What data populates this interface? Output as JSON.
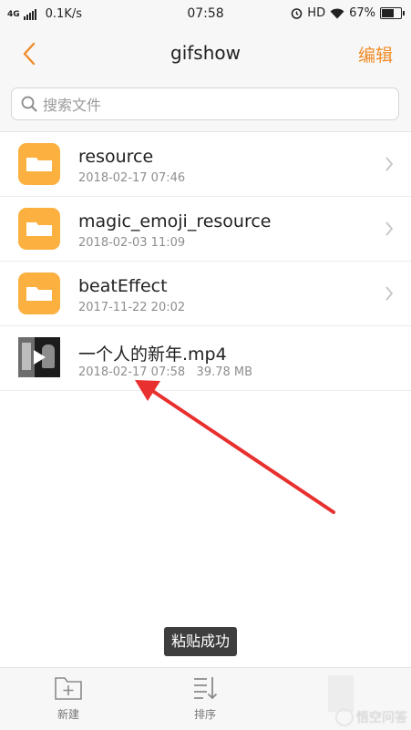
{
  "status_bar": {
    "network": "4G",
    "speed": "0.1K/s",
    "time": "07:58",
    "hd": "HD",
    "battery": "67%"
  },
  "nav": {
    "title": "gifshow",
    "edit_label": "编辑"
  },
  "search": {
    "placeholder": "搜索文件"
  },
  "files": [
    {
      "name": "resource",
      "meta": "2018-02-17 07:46",
      "type": "folder"
    },
    {
      "name": "magic_emoji_resource",
      "meta": "2018-02-03 11:09",
      "type": "folder"
    },
    {
      "name": "beatEffect",
      "meta": "2017-11-22 20:02",
      "type": "folder"
    },
    {
      "name": "一个人的新年.mp4",
      "meta": "2018-02-17 07:58   39.78 MB",
      "type": "video"
    }
  ],
  "toast": "粘贴成功",
  "toolbar": {
    "new_label": "新建",
    "sort_label": "排序"
  },
  "watermark": "悟空问答",
  "colors": {
    "accent": "#f08c28",
    "folder": "#fbb040",
    "arrow": "#e8302e"
  },
  "icons": [
    "back-chevron-icon",
    "search-icon",
    "folder-icon",
    "chevron-right-icon",
    "play-icon",
    "new-folder-icon",
    "sort-icon"
  ]
}
